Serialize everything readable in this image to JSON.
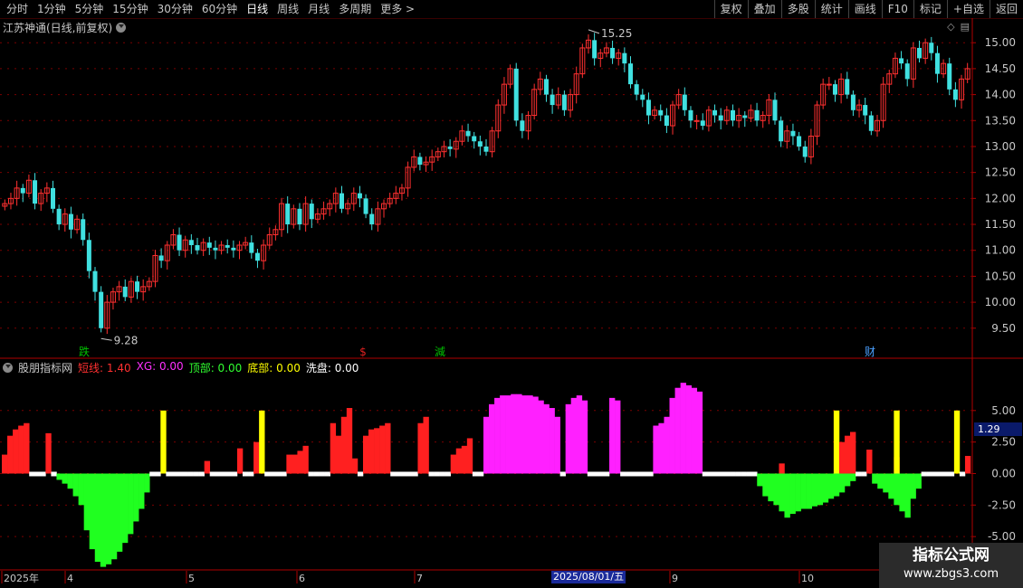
{
  "toolbar": {
    "periods": [
      "分时",
      "1分钟",
      "5分钟",
      "15分钟",
      "30分钟",
      "60分钟",
      "日线",
      "周线",
      "月线",
      "多周期",
      "更多 >"
    ],
    "active_period": "日线",
    "right_buttons": [
      "复权",
      "叠加",
      "多股",
      "统计",
      "画线",
      "F10",
      "标记",
      "+自选",
      "返回"
    ]
  },
  "stock": {
    "title": "江苏神通(日线,前复权)"
  },
  "main_chart": {
    "price_axis_labels": [
      "15.00",
      "14.50",
      "14.00",
      "13.50",
      "13.00",
      "12.50",
      "12.00",
      "11.50",
      "11.00",
      "10.50",
      "10.00",
      "9.50"
    ],
    "high_label": "15.25",
    "low_label": "9.28",
    "event_markers": [
      {
        "text": "跌",
        "color": "#00c000"
      },
      {
        "text": "$",
        "color": "#e02020"
      },
      {
        "text": "減",
        "color": "#00c000"
      },
      {
        "text": "财",
        "color": "#4aa0ff"
      }
    ]
  },
  "indicator": {
    "name": "股朋指标网",
    "items": [
      {
        "label": "短线:",
        "value": "1.40",
        "color": "#ff3030"
      },
      {
        "label": "XG:",
        "value": "0.00",
        "color": "#ff30ff"
      },
      {
        "label": "顶部:",
        "value": "0.00",
        "color": "#30ff30"
      },
      {
        "label": "底部:",
        "value": "0.00",
        "color": "#ffff00"
      },
      {
        "label": "洗盘:",
        "value": "0.00",
        "color": "#ffffff"
      }
    ],
    "axis_labels": [
      "5.00",
      "2.50",
      "0.00",
      "-2.50",
      "-5.00"
    ],
    "current_value": "1.29"
  },
  "time_axis": {
    "labels": [
      "2025年",
      "4",
      "5",
      "6",
      "7",
      "9",
      "10"
    ],
    "highlight": "2025/08/01/五"
  },
  "watermark": {
    "line1": "指标公式网",
    "line2": "www.zbgs3.com"
  },
  "colors": {
    "up": "#ff3030",
    "down": "#40e0e0",
    "grid": "#7a0000",
    "axis": "#b00000"
  },
  "chart_data": [
    {
      "type": "candlestick",
      "title": "江苏神通(日线,前复权)",
      "ylim": [
        9.2,
        15.3
      ],
      "close": [
        11.9,
        12.0,
        12.2,
        12.1,
        12.35,
        11.9,
        12.1,
        12.2,
        11.8,
        11.5,
        11.7,
        11.4,
        11.6,
        11.2,
        10.6,
        10.2,
        9.5,
        10.0,
        10.2,
        10.3,
        10.1,
        10.4,
        10.2,
        10.3,
        10.4,
        10.9,
        10.8,
        11.1,
        11.3,
        11.0,
        11.2,
        11.1,
        11.0,
        11.15,
        11.05,
        11.0,
        11.1,
        11.05,
        11.0,
        11.1,
        11.15,
        10.95,
        10.8,
        11.1,
        11.3,
        11.4,
        11.9,
        11.5,
        11.8,
        11.5,
        11.9,
        11.6,
        11.7,
        11.8,
        11.9,
        12.1,
        11.8,
        11.9,
        12.1,
        12.0,
        11.7,
        11.5,
        11.8,
        11.9,
        12.0,
        12.1,
        12.2,
        12.6,
        12.8,
        12.65,
        12.7,
        12.8,
        12.9,
        13.0,
        12.95,
        13.1,
        13.3,
        13.2,
        13.1,
        13.0,
        12.9,
        13.3,
        13.8,
        14.2,
        14.5,
        13.5,
        13.3,
        13.6,
        14.1,
        14.3,
        14.0,
        13.8,
        14.0,
        13.7,
        14.0,
        14.4,
        14.9,
        15.05,
        14.7,
        14.8,
        14.9,
        14.7,
        14.8,
        14.6,
        14.2,
        14.0,
        13.9,
        13.6,
        13.7,
        13.6,
        13.4,
        13.8,
        14.0,
        13.7,
        13.5,
        13.5,
        13.4,
        13.7,
        13.6,
        13.5,
        13.7,
        13.5,
        13.6,
        13.55,
        13.7,
        13.5,
        13.6,
        13.9,
        13.5,
        13.1,
        13.3,
        13.2,
        13.0,
        12.8,
        13.2,
        13.8,
        14.2,
        14.2,
        14.0,
        14.3,
        14.0,
        13.7,
        13.8,
        13.6,
        13.3,
        13.5,
        14.2,
        14.4,
        14.7,
        14.6,
        14.3,
        14.9,
        14.7,
        15.0,
        14.8,
        14.4,
        14.6,
        14.1,
        13.9,
        14.3,
        14.5
      ]
    },
    {
      "type": "bar",
      "title": "股朋指标网",
      "ylim": [
        -7.5,
        8.0
      ],
      "series": [
        {
          "name": "短线",
          "color": "#ff2020",
          "values": [
            1.5,
            3.0,
            3.5,
            3.8,
            4.0,
            0,
            0,
            0,
            3.2,
            0,
            0,
            0,
            0,
            0,
            0,
            0,
            0,
            0,
            0,
            0,
            0,
            0,
            0,
            0,
            0,
            0,
            0,
            0,
            0,
            0,
            0,
            0,
            0,
            0,
            0,
            0,
            0,
            1.0,
            0,
            0,
            0,
            0,
            0,
            2.0,
            0,
            0,
            2.5,
            0,
            0,
            0,
            0,
            0,
            1.5,
            1.5,
            1.8,
            2.2,
            0,
            0,
            0,
            0,
            4.0,
            3.0,
            4.5,
            5.2,
            1.2,
            0,
            3.0,
            3.5,
            3.6,
            3.8,
            4.0,
            0,
            0,
            0,
            0,
            0,
            4.0,
            4.5,
            0,
            0,
            0,
            0,
            1.5,
            2.0,
            2.2,
            2.8,
            0,
            0,
            0,
            0,
            0,
            0,
            0,
            0,
            0,
            0,
            0,
            0,
            0,
            0,
            0,
            0,
            0,
            0,
            0,
            0,
            0,
            0,
            0,
            0,
            0,
            0,
            0,
            0,
            0,
            0,
            0,
            0,
            0,
            0,
            0,
            0,
            0,
            0,
            0,
            0,
            0,
            0,
            0,
            0,
            0,
            0,
            0,
            0,
            0,
            0,
            0,
            0,
            0,
            0,
            0,
            0,
            0.8,
            0,
            0,
            0,
            0,
            0,
            0,
            0,
            0,
            0,
            0,
            2.5,
            3.0,
            3.3,
            0,
            0,
            1.9,
            0,
            0,
            0,
            0,
            1.3,
            0,
            0,
            0,
            0,
            0,
            0,
            0,
            0,
            0,
            0,
            0,
            0,
            1.4
          ]
        },
        {
          "name": "XG",
          "color": "#ff20ff",
          "values": [
            0,
            0,
            0,
            0,
            0,
            0,
            0,
            0,
            0,
            0,
            0,
            0,
            0,
            0,
            0,
            0,
            0,
            0,
            0,
            0,
            0,
            0,
            0,
            0,
            0,
            0,
            0,
            0,
            0,
            0,
            0,
            0,
            0,
            0,
            0,
            0,
            0,
            0,
            0,
            0,
            0,
            0,
            0,
            0,
            0,
            0,
            0,
            0,
            0,
            0,
            0,
            0,
            0,
            0,
            0,
            0,
            0,
            0,
            0,
            0,
            0,
            0,
            0,
            0,
            0,
            0,
            0,
            0,
            0,
            0,
            0,
            0,
            0,
            0,
            0,
            0,
            0,
            0,
            0,
            0,
            0,
            0,
            0,
            0,
            0,
            0,
            0,
            0,
            4.5,
            5.5,
            6.0,
            6.2,
            6.2,
            6.3,
            6.3,
            6.2,
            6.2,
            6.1,
            5.8,
            5.5,
            5.2,
            4.5,
            0,
            5.5,
            6.0,
            6.2,
            5.8,
            0,
            0,
            0,
            0,
            6.0,
            5.8,
            0,
            0,
            0,
            0,
            0,
            0,
            3.8,
            4.0,
            4.5,
            6.0,
            6.8,
            7.2,
            7.0,
            6.8,
            6.5,
            0,
            0,
            0,
            0,
            0,
            0,
            0,
            0,
            0,
            0,
            0,
            0,
            0,
            0,
            0,
            0,
            0,
            0,
            0,
            0,
            0,
            0,
            0,
            0,
            0,
            0,
            0,
            0,
            0,
            0,
            0,
            0,
            0,
            0,
            0,
            0,
            0,
            0,
            0,
            0,
            0,
            0,
            0,
            0,
            0,
            0,
            0,
            0,
            0,
            0,
            0,
            0,
            0,
            0,
            0,
            0,
            0,
            0,
            0,
            0,
            0,
            0,
            0,
            0,
            0,
            0,
            1.5,
            2.5,
            3.0,
            4.0,
            4.5,
            4.8,
            5.2,
            5.5,
            0,
            0,
            0,
            0,
            0,
            0
          ]
        },
        {
          "name": "顶部",
          "color": "#20ff20",
          "values": [
            0,
            0,
            0,
            0,
            0,
            0,
            0,
            0,
            0,
            0,
            -0.5,
            -0.8,
            -1.2,
            -1.8,
            -2.5,
            -4.5,
            -6.0,
            -7.0,
            -7.4,
            -7.2,
            -6.8,
            -6.2,
            -5.5,
            -4.8,
            -3.8,
            -2.8,
            -1.5,
            0,
            0,
            0,
            0,
            0,
            0,
            0,
            0,
            0,
            0,
            0,
            0,
            0,
            0,
            0,
            0,
            0,
            0,
            0,
            0,
            0,
            0,
            0,
            0,
            0,
            0,
            0,
            0,
            0,
            0,
            0,
            0,
            0,
            0,
            0,
            0,
            0,
            0,
            0,
            0,
            0,
            0,
            0,
            0,
            0,
            0,
            0,
            0,
            0,
            0,
            0,
            0,
            0,
            0,
            0,
            0,
            0,
            0,
            0,
            0,
            0,
            0,
            0,
            0,
            0,
            0,
            0,
            0,
            0,
            0,
            0,
            0,
            0,
            0,
            0,
            0,
            0,
            0,
            0,
            0,
            0,
            0,
            0,
            0,
            0,
            0,
            0,
            0,
            0,
            0,
            0,
            0,
            0,
            0,
            0,
            0,
            0,
            0,
            0,
            0,
            0,
            0,
            0,
            0,
            0,
            0,
            0,
            0,
            0,
            0,
            0,
            -1.0,
            -1.8,
            -2.2,
            -2.5,
            -3.0,
            -3.5,
            -3.2,
            -3.0,
            -2.8,
            -2.8,
            -2.6,
            -2.5,
            -2.3,
            -2.0,
            -1.8,
            -1.5,
            -1.0,
            -0.6,
            0,
            0,
            0,
            -0.8,
            -1.2,
            -1.5,
            -2.0,
            -2.5,
            -3.0,
            -3.5,
            -2.0,
            -1.2,
            0,
            0,
            0,
            0,
            0,
            0,
            0,
            0,
            0,
            0,
            0,
            0,
            0,
            0,
            0,
            0,
            0,
            0,
            0,
            0,
            0,
            0,
            0,
            0,
            0,
            0
          ]
        },
        {
          "name": "底部",
          "color": "#ffff00",
          "values": [
            0,
            0,
            0,
            0,
            0,
            0,
            0,
            0,
            0,
            0,
            0,
            0,
            0,
            0,
            0,
            0,
            0,
            0,
            0,
            0,
            0,
            0,
            0,
            0,
            0,
            0,
            0,
            0,
            0,
            5.0,
            0,
            0,
            0,
            0,
            0,
            0,
            0,
            0,
            0,
            0,
            0,
            0,
            0,
            0,
            0,
            0,
            0,
            5.0,
            0,
            0,
            0,
            0,
            0,
            0,
            0,
            0,
            0,
            0,
            0,
            0,
            0,
            0,
            0,
            0,
            0,
            0,
            0,
            0,
            0,
            0,
            0,
            0,
            0,
            0,
            0,
            0,
            0,
            0,
            0,
            0,
            0,
            0,
            0,
            0,
            0,
            0,
            0,
            0,
            0,
            0,
            0,
            0,
            0,
            0,
            0,
            0,
            0,
            0,
            0,
            0,
            0,
            0,
            0,
            0,
            0,
            0,
            0,
            0,
            0,
            0,
            0,
            0,
            0,
            0,
            0,
            0,
            0,
            0,
            0,
            0,
            0,
            0,
            0,
            0,
            0,
            0,
            0,
            0,
            0,
            0,
            0,
            0,
            0,
            0,
            0,
            0,
            0,
            0,
            0,
            0,
            0,
            0,
            0,
            0,
            0,
            0,
            0,
            0,
            0,
            0,
            0,
            0,
            5.0,
            0,
            0,
            0,
            0,
            0,
            0,
            0,
            0,
            0,
            0,
            5.0,
            0,
            0,
            0,
            0,
            0,
            0,
            0,
            0,
            0,
            0,
            5.0,
            0,
            0,
            0,
            0,
            0,
            0,
            0,
            0,
            0,
            0,
            0,
            0,
            0
          ]
        }
      ]
    }
  ]
}
